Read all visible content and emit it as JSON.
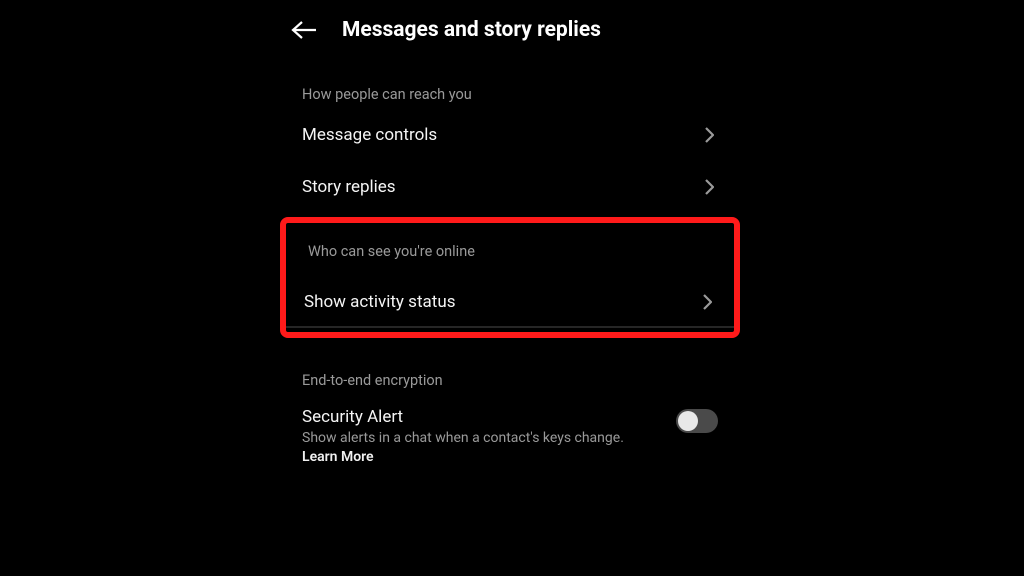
{
  "header": {
    "title": "Messages and story replies"
  },
  "section1": {
    "label": "How people can reach you",
    "items": [
      {
        "label": "Message controls"
      },
      {
        "label": "Story replies"
      }
    ]
  },
  "section2": {
    "label": "Who can see you're online",
    "items": [
      {
        "label": "Show activity status"
      }
    ]
  },
  "section3": {
    "label": "End-to-end encryption",
    "toggle": {
      "title": "Security Alert",
      "desc_prefix": "Show alerts in a chat when a contact's keys change. ",
      "learn_more": "Learn More",
      "enabled": false
    }
  }
}
